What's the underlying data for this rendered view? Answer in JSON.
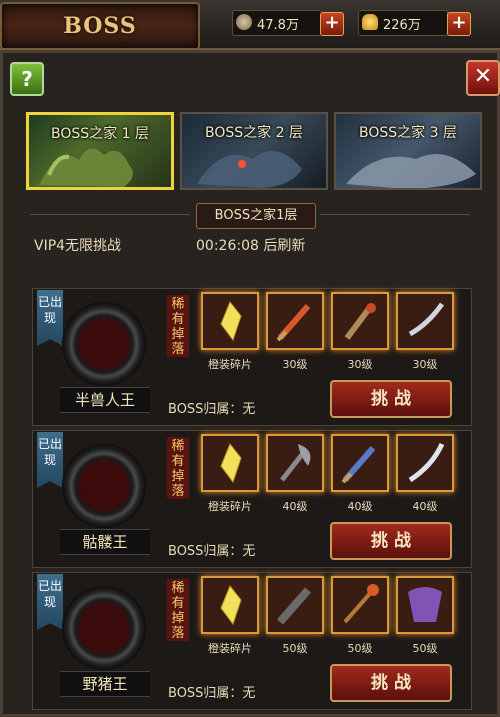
{
  "header": {
    "title": "BOSS",
    "currency1": "47.8万",
    "currency2": "226万",
    "plus": "+"
  },
  "buttons": {
    "help": "?",
    "close": "✕"
  },
  "tabs": [
    {
      "label": "BOSS之家 1 层"
    },
    {
      "label": "BOSS之家 2 层"
    },
    {
      "label": "BOSS之家 3 层"
    }
  ],
  "floor_title": "BOSS之家1层",
  "info": {
    "vip": "VIP4无限挑战",
    "timer": "00:26:08 后刷新"
  },
  "rare_label": "稀有掉落",
  "appeared_label": "已出现",
  "owner_label": "BOSS归属：无",
  "fight_label": "挑 战",
  "bosses": [
    {
      "name": "半兽人王",
      "drops": [
        "橙装碎片",
        "30级",
        "30级",
        "30级"
      ]
    },
    {
      "name": "骷髅王",
      "drops": [
        "橙装碎片",
        "40级",
        "40级",
        "40级"
      ]
    },
    {
      "name": "野猪王",
      "drops": [
        "橙装碎片",
        "50级",
        "50级",
        "50级"
      ]
    }
  ],
  "colors": {
    "accent": "#f0d33a",
    "fight": "#a12a1c",
    "appeared": "#3d6e8d"
  }
}
